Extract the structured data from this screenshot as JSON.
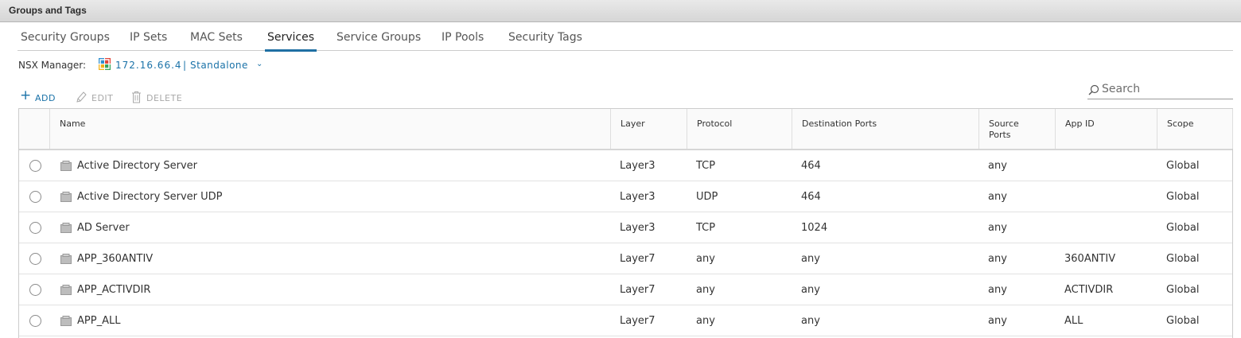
{
  "window": {
    "title": "Groups and Tags"
  },
  "tabs": [
    {
      "label": "Security Groups",
      "active": false
    },
    {
      "label": "IP Sets",
      "active": false
    },
    {
      "label": "MAC Sets",
      "active": false
    },
    {
      "label": "Services",
      "active": true
    },
    {
      "label": "Service Groups",
      "active": false
    },
    {
      "label": "IP Pools",
      "active": false
    },
    {
      "label": "Security Tags",
      "active": false
    }
  ],
  "nsx_manager": {
    "label": "NSX Manager:",
    "ip": "172.16.66.4",
    "separator": "|",
    "mode": "Standalone",
    "icon": "nsx-manager-icon",
    "dropdown_icon": "chevron-down-icon"
  },
  "toolbar": {
    "add_label": "ADD",
    "edit_label": "EDIT",
    "delete_label": "DELETE",
    "add_icon": "plus-icon",
    "edit_icon": "pencil-icon",
    "delete_icon": "trash-icon"
  },
  "search": {
    "placeholder": "Search",
    "icon": "search-icon"
  },
  "table": {
    "columns": [
      "Name",
      "Layer",
      "Protocol",
      "Destination Ports",
      "Source\nPorts",
      "App ID",
      "Scope"
    ],
    "rows": [
      {
        "name": "Active Directory Server",
        "layer": "Layer3",
        "protocol": "TCP",
        "dest_ports": "464",
        "source_ports": "any",
        "app_id": "",
        "scope": "Global"
      },
      {
        "name": "Active Directory Server UDP",
        "layer": "Layer3",
        "protocol": "UDP",
        "dest_ports": "464",
        "source_ports": "any",
        "app_id": "",
        "scope": "Global"
      },
      {
        "name": "AD Server",
        "layer": "Layer3",
        "protocol": "TCP",
        "dest_ports": "1024",
        "source_ports": "any",
        "app_id": "",
        "scope": "Global"
      },
      {
        "name": "APP_360ANTIV",
        "layer": "Layer7",
        "protocol": "any",
        "dest_ports": "any",
        "source_ports": "any",
        "app_id": "360ANTIV",
        "scope": "Global"
      },
      {
        "name": "APP_ACTIVDIR",
        "layer": "Layer7",
        "protocol": "any",
        "dest_ports": "any",
        "source_ports": "any",
        "app_id": "ACTIVDIR",
        "scope": "Global"
      },
      {
        "name": "APP_ALL",
        "layer": "Layer7",
        "protocol": "any",
        "dest_ports": "any",
        "source_ports": "any",
        "app_id": "ALL",
        "scope": "Global"
      }
    ]
  },
  "colors": {
    "accent": "#1a72a8",
    "active_tab_underline": "#1f6fa3",
    "disabled": "#a8a8a8"
  }
}
